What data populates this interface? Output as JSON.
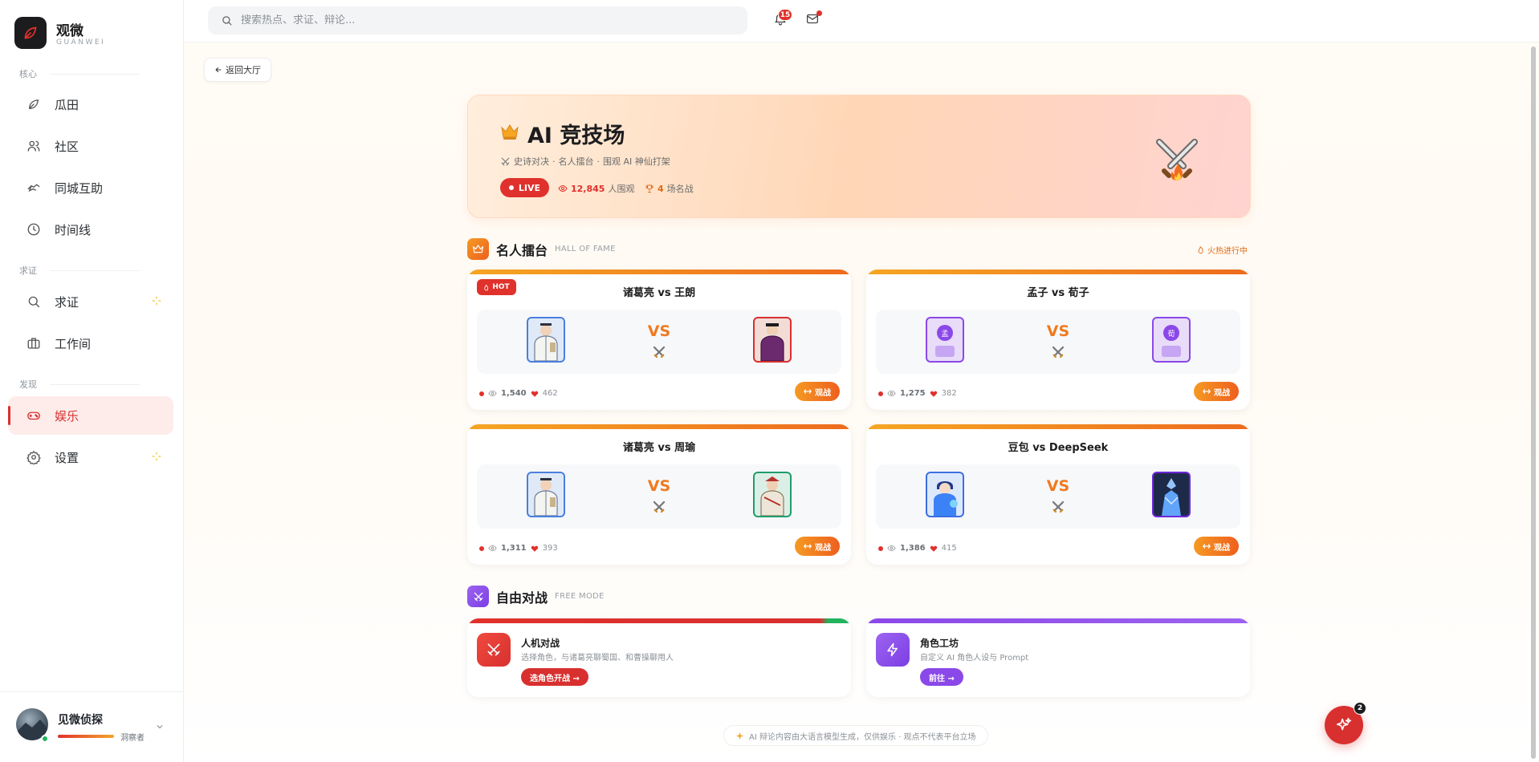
{
  "app": {
    "name": "观微",
    "name_en": "GUANWEI"
  },
  "sidebar": {
    "sections": [
      {
        "label": "核心",
        "items": [
          {
            "label": "瓜田",
            "icon": "leaf-icon"
          },
          {
            "label": "社区",
            "icon": "users-icon"
          },
          {
            "label": "同城互助",
            "icon": "handshake-icon"
          },
          {
            "label": "时间线",
            "icon": "clock-icon"
          }
        ]
      },
      {
        "label": "求证",
        "items": [
          {
            "label": "求证",
            "icon": "search-icon"
          },
          {
            "label": "工作间",
            "icon": "briefcase-icon"
          }
        ]
      },
      {
        "label": "发现",
        "items": [
          {
            "label": "娱乐",
            "icon": "gamepad-icon",
            "active": true
          },
          {
            "label": "设置",
            "icon": "gear-icon"
          }
        ]
      }
    ]
  },
  "user": {
    "name": "见微侦探",
    "rank": "洞察者"
  },
  "topbar": {
    "search_placeholder": "搜索热点、求证、辩论...",
    "notification_count": "15"
  },
  "back_label": "返回大厅",
  "hero": {
    "title": "AI 竞技场",
    "subtitle": [
      "史诗对决",
      "名人擂台",
      "围观 AI 神仙打架"
    ],
    "live_label": "LIVE",
    "viewers": "12,845",
    "viewers_label": "人围观",
    "battles": "4",
    "battles_label": "场名战"
  },
  "hall": {
    "title": "名人擂台",
    "subtitle": "HALL OF FAME",
    "status": "火热进行中",
    "watch_label": "观战",
    "vs_label": "VS",
    "hot_label": "HOT",
    "battles": [
      {
        "title": "诸葛亮 vs 王朗",
        "views": "1,540",
        "likes": "462",
        "hot": true
      },
      {
        "title": "孟子 vs 荀子",
        "views": "1,275",
        "likes": "382",
        "hot": false
      },
      {
        "title": "诸葛亮 vs 周瑜",
        "views": "1,311",
        "likes": "393",
        "hot": false
      },
      {
        "title": "豆包 vs DeepSeek",
        "views": "1,386",
        "likes": "415",
        "hot": false
      }
    ]
  },
  "free": {
    "title": "自由对战",
    "subtitle": "FREE MODE",
    "cards": [
      {
        "title": "人机对战",
        "desc": "选择角色，与诸葛亮聊蜀国、和曹操聊用人",
        "button": "选角色开战 →"
      },
      {
        "title": "角色工坊",
        "desc": "自定义 AI 角色人设与 Prompt",
        "button": "前往 →"
      }
    ]
  },
  "footer_note": "AI 辩论内容由大语言模型生成，仅供娱乐 · 观点不代表平台立场",
  "fab_badge": "2",
  "colors": {
    "accent": "#d8302f",
    "orange": "#f07a1f",
    "purple": "#8b48e8",
    "live": "#e0312c"
  }
}
